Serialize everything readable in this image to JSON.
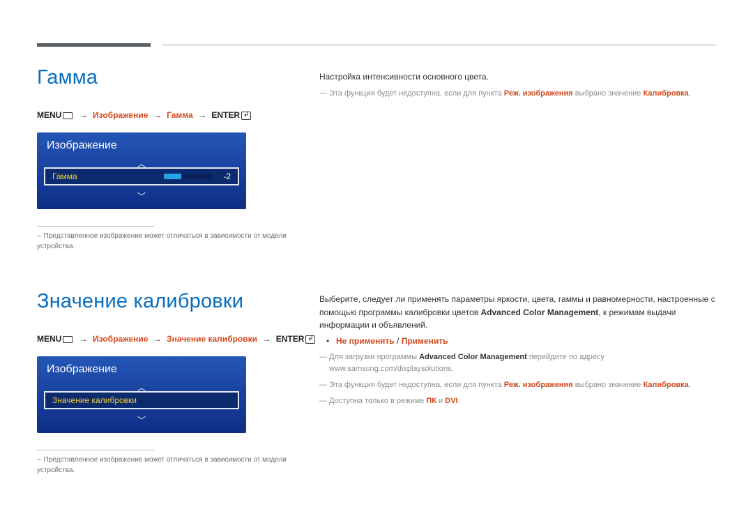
{
  "section1": {
    "title": "Гамма",
    "breadcrumb": {
      "menu": "MENU",
      "p1": "Изображение",
      "p2": "Гамма",
      "enter": "ENTER"
    },
    "menu": {
      "header": "Изображение",
      "item_label": "Гамма",
      "item_value": "-2"
    },
    "footnote": "Представленное изображение может отличаться в зависимости от модели устройства."
  },
  "section2": {
    "title": "Значение калибровки",
    "breadcrumb": {
      "menu": "MENU",
      "p1": "Изображение",
      "p2": "Значение калибровки",
      "enter": "ENTER"
    },
    "menu": {
      "header": "Изображение",
      "item_label": "Значение калибровки"
    },
    "footnote": "Представленное изображение может отличаться в зависимости от модели устройства."
  },
  "right1": {
    "line1": "Настройка интенсивности основного цвета.",
    "note1_a": "Эта функция будет недоступна, если для пункта ",
    "note1_hl1": "Реж. изображения",
    "note1_b": " выбрано значение ",
    "note1_hl2": "Калибровка",
    "note1_c": "."
  },
  "right2": {
    "para_a": "Выберите, следует ли применять параметры яркости, цвета, гаммы и равномерности, настроенные с помощью программы калибровки цветов ",
    "para_b_bold": "Advanced Color Management",
    "para_c": ", к режимам выдачи информации и объявлений.",
    "opt1": "Не применять",
    "opt_sep": " / ",
    "opt2": "Применить",
    "note1_a": "Для загрузки программы ",
    "note1_bold": "Advanced Color Management",
    "note1_b": " перейдите по адресу www.samsung.com/displaysolutions.",
    "note2_a": "Эта функция будет недоступна, если для пункта ",
    "note2_hl1": "Реж. изображения",
    "note2_b": " выбрано значение ",
    "note2_hl2": "Калибровка",
    "note2_c": ".",
    "note3_a": "Доступна только в режиме ",
    "note3_hl1": "ПК",
    "note3_mid": " и ",
    "note3_hl2": "DVI",
    "note3_c": "."
  }
}
